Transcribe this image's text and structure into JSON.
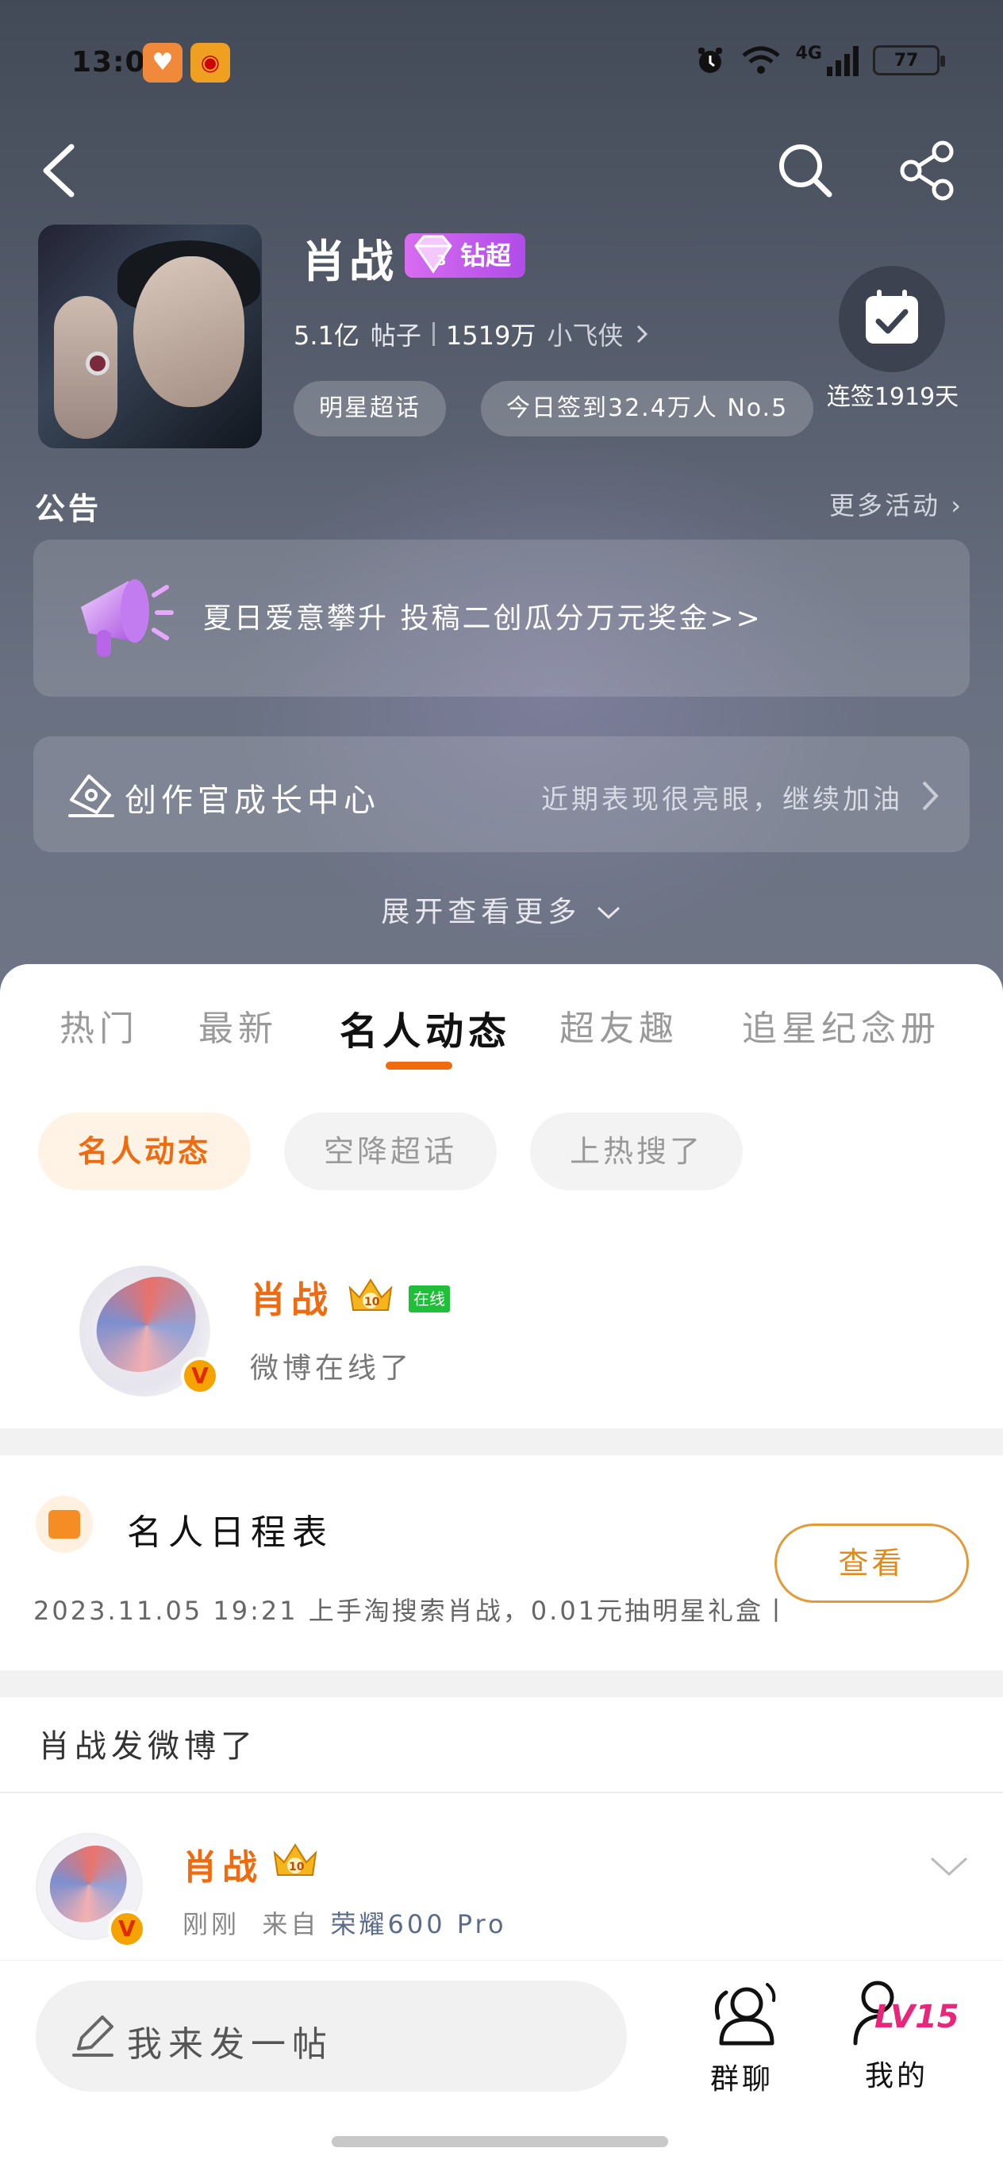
{
  "status_bar": {
    "time": "13:05",
    "network": "4G",
    "wifi_sub": "6",
    "battery": "77"
  },
  "profile": {
    "name": "肖战",
    "badge": "钻超",
    "posts_count": "5.1亿",
    "posts_label": "帖子",
    "fans_count": "1519万",
    "fans_label": "小飞侠",
    "chip_category": "明星超话",
    "chip_checkin": "今日签到32.4万人 No.5",
    "checkin_days": "连签1919天"
  },
  "notice": {
    "title": "公告",
    "more": "更多活动",
    "text": "夏日爱意攀升 投稿二创瓜分万元奖金>>"
  },
  "creator": {
    "title": "创作官成长中心",
    "subtitle": "近期表现很亮眼，继续加油"
  },
  "expand_label": "展开查看更多",
  "tabs": [
    {
      "label": "热门"
    },
    {
      "label": "最新"
    },
    {
      "label": "名人动态"
    },
    {
      "label": "超友趣"
    },
    {
      "label": "追星纪念册"
    }
  ],
  "subchips": [
    {
      "label": "名人动态"
    },
    {
      "label": "空降超话"
    },
    {
      "label": "上热搜了"
    }
  ],
  "online": {
    "name": "肖战",
    "tag": "在线",
    "text": "微博在线了"
  },
  "schedule": {
    "title": "名人日程表",
    "text": "2023.11.05 19:21 上手淘搜索肖战，0.01元抽明星礼盒丨",
    "button": "查看"
  },
  "posted": {
    "title": "肖战发微博了",
    "name": "肖战",
    "time": "刚刚",
    "from": "来自",
    "device": "荣耀600 Pro"
  },
  "bottom": {
    "compose_placeholder": "我来发一帖",
    "group_label": "群聊",
    "mine_label": "我的",
    "level": "LV15"
  },
  "colors": {
    "accent": "#f06a0f",
    "badge_purple": "#c05aec",
    "online_green": "#1fbf3a"
  }
}
